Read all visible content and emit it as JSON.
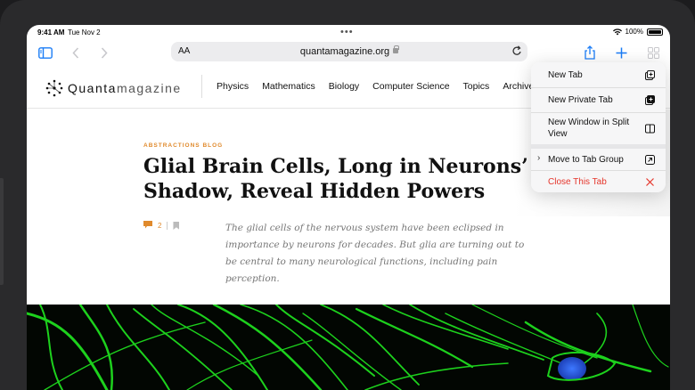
{
  "status_bar": {
    "time": "9:41 AM",
    "date": "Tue Nov 2",
    "battery": "100%",
    "battery_level": 1.0
  },
  "toolbar": {
    "text_size_label": "AA",
    "url": "quantamagazine.org",
    "icons": [
      "sidebar-icon",
      "back-icon",
      "forward-icon",
      "lock-icon",
      "reload-icon",
      "share-icon",
      "new-tab-icon",
      "tabs-icon"
    ]
  },
  "site": {
    "logo": {
      "bold": "Quanta",
      "light": "magazine"
    },
    "nav": [
      "Physics",
      "Mathematics",
      "Biology",
      "Computer Science",
      "Topics",
      "Archive"
    ]
  },
  "article": {
    "kicker": "ABSTRACTIONS BLOG",
    "headline": "Glial Brain Cells, Long in Neurons’ Shadow, Reveal Hidden Powers",
    "comments": "2",
    "dek": "The glial cells of the nervous system have been eclipsed in importance by neurons for decades. But glia are turning out to be central to many neurological functions, including pain perception."
  },
  "menu": {
    "items": [
      {
        "label": "New Tab",
        "icon": "new-tab-plus-icon"
      },
      {
        "label": "New Private Tab",
        "icon": "private-tab-icon"
      },
      {
        "label": "New Window in Split View",
        "icon": "split-view-icon"
      },
      {
        "label": "Move to Tab Group",
        "icon": "move-arrow-icon",
        "has_submenu": true
      },
      {
        "label": "Close This Tab",
        "icon": "close-icon",
        "destructive": true
      }
    ]
  },
  "colors": {
    "accent": "#1a7cf6",
    "kicker": "#e08a2c",
    "destructive": "#e5352b",
    "hero_cells": "#1dd11d",
    "hero_nucleus": "#2f62e6"
  }
}
